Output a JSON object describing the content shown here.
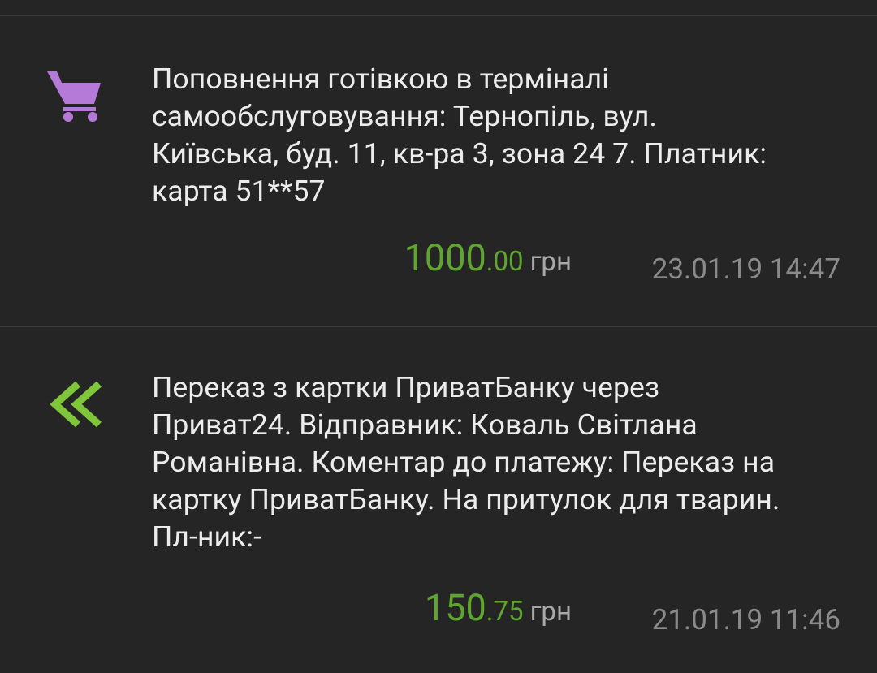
{
  "colors": {
    "background": "#252525",
    "divider": "#3d3d3d",
    "text_primary": "#ececec",
    "amount_green": "#5fa62f",
    "currency_gray": "#a8a8a8",
    "time_gray": "#8a8a8a",
    "cart_icon_purple": "#b57ad8",
    "incoming_icon_green": "#7fc63b"
  },
  "transactions": [
    {
      "icon": "shopping-cart-icon",
      "description": "Поповнення готівкою в терміналі\nсамообслуговування: Тернопіль, вул.\nКиївська, буд. 11, кв-ра 3, зона 24 7. Платник:\nкарта 51**57",
      "amount_int": "1000",
      "amount_frac": ".00",
      "currency": "грн",
      "datetime": "23.01.19 14:47"
    },
    {
      "icon": "double-chevron-left-icon",
      "description": "Переказ з картки ПриватБанку через\nПриват24. Відправник: Коваль Світлана\nРоманівна. Коментар до платежу: Переказ на\nкартку ПриватБанку. На притулок для тварин.\nПл-ник:-",
      "amount_int": "150",
      "amount_frac": ".75",
      "currency": "грн",
      "datetime": "21.01.19 11:46"
    }
  ]
}
